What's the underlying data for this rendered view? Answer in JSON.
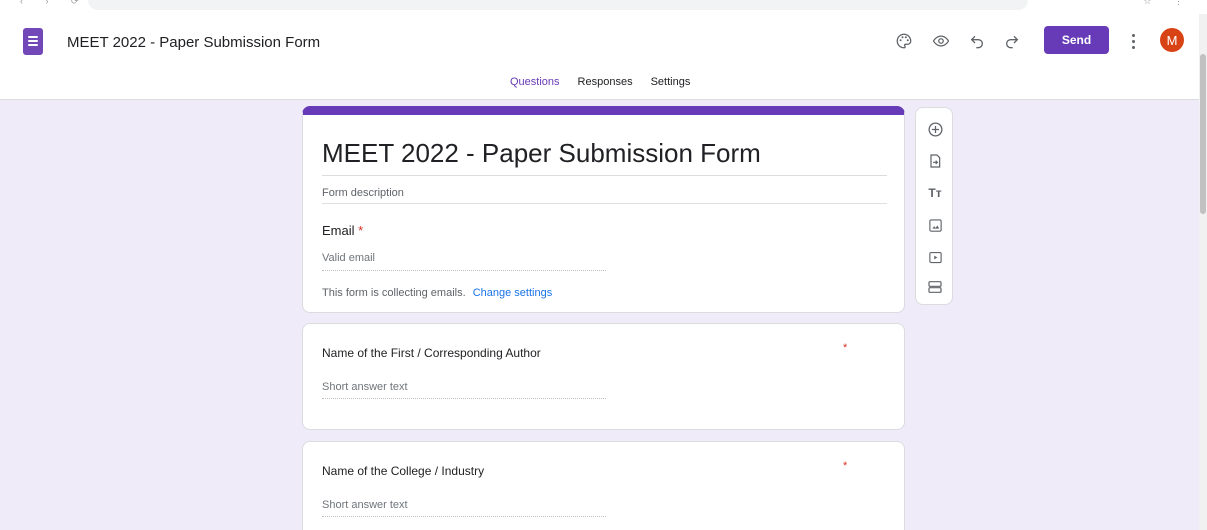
{
  "header": {
    "doc_title": "MEET 2022 - Paper Submission Form",
    "send_label": "Send",
    "avatar_letter": "M"
  },
  "tabs": [
    {
      "label": "Questions",
      "active": true
    },
    {
      "label": "Responses",
      "active": false
    },
    {
      "label": "Settings",
      "active": false
    }
  ],
  "form": {
    "title": "MEET 2022 - Paper Submission Form",
    "description_placeholder": "Form description",
    "email_label": "Email",
    "required_mark": "*",
    "email_placeholder": "Valid email",
    "collect_note": "This form is collecting emails.",
    "change_settings_link": "Change settings"
  },
  "questions": [
    {
      "title": "Name of the First / Corresponding Author",
      "required": "*",
      "placeholder": "Short answer text"
    },
    {
      "title": "Name of the College / Industry",
      "required": "*",
      "placeholder": "Short answer text"
    }
  ],
  "toolbar_icons": [
    "add-question-icon",
    "import-questions-icon",
    "add-title-icon",
    "add-image-icon",
    "add-video-icon",
    "add-section-icon"
  ],
  "colors": {
    "accent": "#673ab7",
    "background": "#f0ebf8",
    "link": "#1a73e8",
    "required": "#d93025",
    "avatar": "#d84315"
  }
}
